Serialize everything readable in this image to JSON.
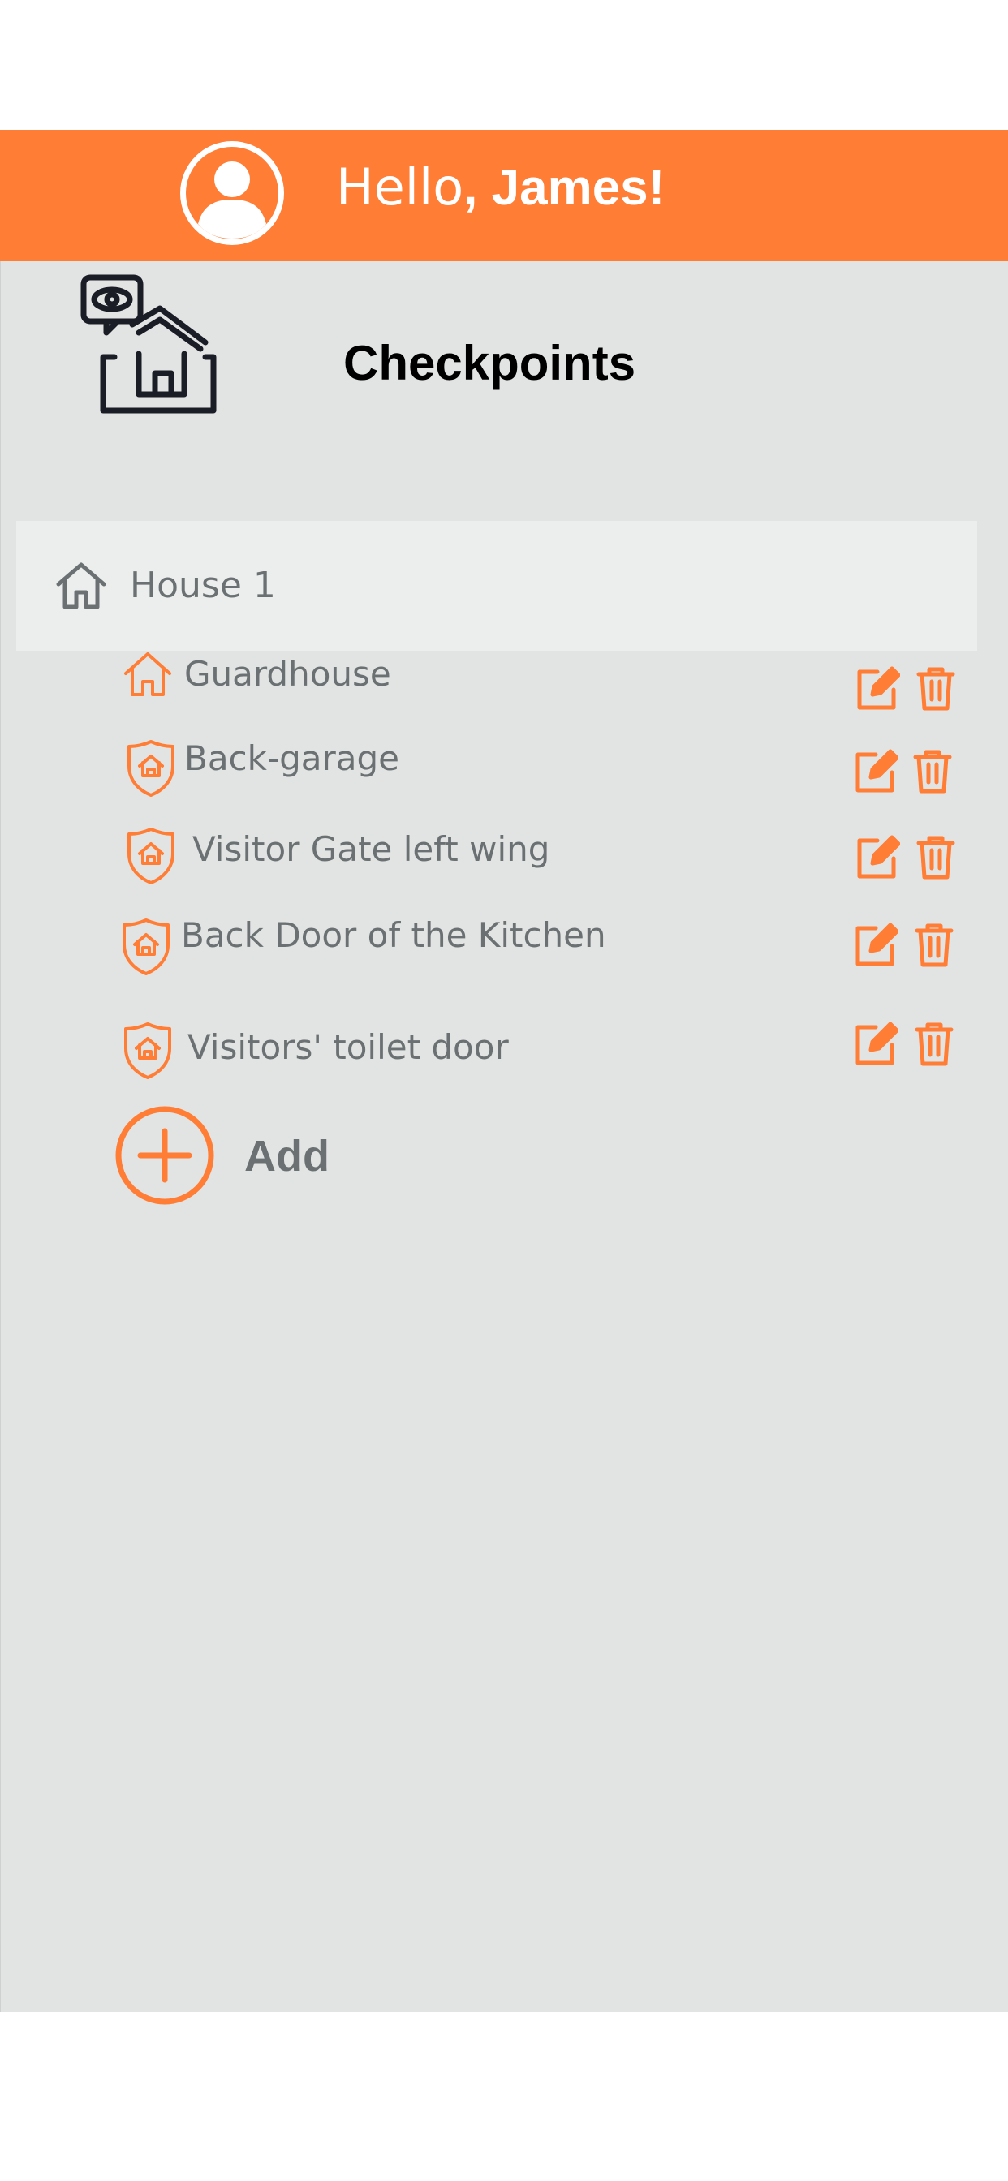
{
  "header": {
    "greeting_prefix": "Hello",
    "user_name": ", James!"
  },
  "page": {
    "title": "Checkpoints"
  },
  "group": {
    "label": "House 1"
  },
  "checkpoints": [
    {
      "label": "Guardhouse",
      "icon": "house-outline-icon"
    },
    {
      "label": "Back-garage",
      "icon": "shield-house-icon"
    },
    {
      "label": "Visitor Gate left wing",
      "icon": "shield-house-icon"
    },
    {
      "label": "Back Door of the Kitchen",
      "icon": "shield-house-icon"
    },
    {
      "label": "Visitors' toilet door",
      "icon": "shield-house-icon"
    }
  ],
  "add": {
    "label": "Add"
  },
  "colors": {
    "accent": "#ff7d34",
    "panel_bg": "#e2e3e3",
    "group_bg": "#eceeed",
    "text_gray": "#6b7172"
  }
}
